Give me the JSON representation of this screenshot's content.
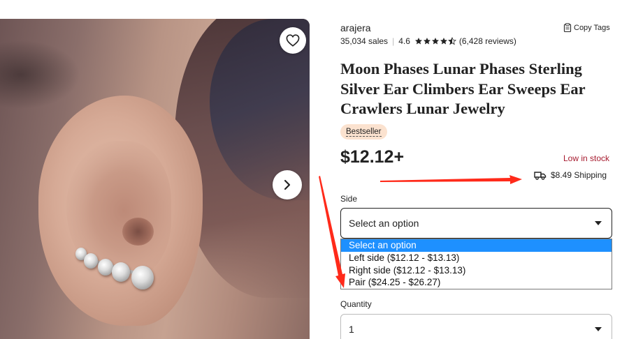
{
  "shop": {
    "name": "arajera",
    "sales": "35,034 sales",
    "rating": "4.6",
    "reviews": "(6,428 reviews)",
    "copy_tags": "Copy Tags"
  },
  "product": {
    "title": "Moon Phases Lunar Phases Sterling Silver Ear Climbers Ear Sweeps Ear Crawlers Lunar Jewelry",
    "badge": "Bestseller",
    "price": "$12.12+",
    "stock": "Low in stock",
    "shipping": "$8.49 Shipping"
  },
  "side": {
    "label": "Side",
    "selected": "Select an option",
    "options": [
      "Select an option",
      "Left side ($12.12 - $13.13)",
      "Right side ($12.12 - $13.13)",
      "Pair ($24.25 - $26.27)"
    ]
  },
  "quantity": {
    "label": "Quantity",
    "value": "1"
  },
  "icons": {
    "favorite": "heart-icon",
    "next": "chevron-right-icon",
    "copy": "clipboard-icon",
    "shipping": "truck-icon",
    "dropdown": "caret-down-icon"
  },
  "colors": {
    "stock_red": "#a61a2e",
    "badge_bg": "#fbe2cf",
    "selected_option": "#1e90ff",
    "annotation_arrow": "#ff2a1a"
  }
}
